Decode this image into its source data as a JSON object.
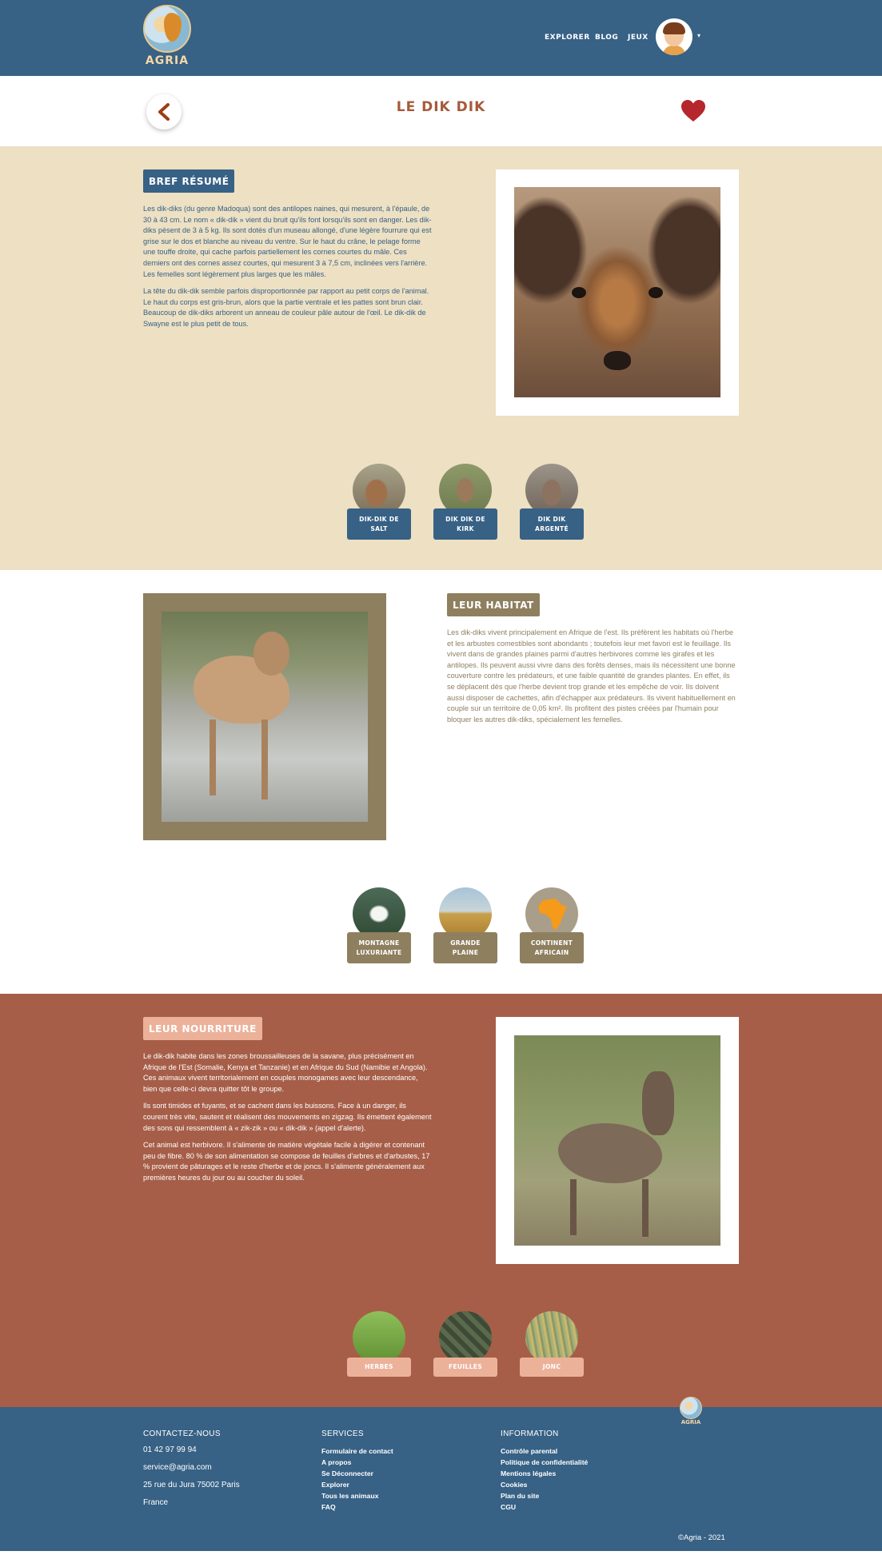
{
  "header": {
    "logo_text": "AGRIA",
    "nav": [
      "EXPLORER",
      "BLOG",
      "JEUX"
    ]
  },
  "title": "LE DIK DIK",
  "resume": {
    "tag": "BREF RÉSUMÉ",
    "paragraphs": [
      "Les dik-diks (du genre Madoqua) sont des antilopes naines, qui mesurent, à l'épaule, de 30 à 43 cm. Le nom « dik-dik » vient du bruit qu'ils font lorsqu'ils sont en danger. Les dik-diks pèsent de 3 à 5 kg. Ils sont dotés d'un museau allongé, d'une légère fourrure qui est grise sur le dos et blanche au niveau du ventre. Sur le haut du crâne, le pelage forme une touffe droite, qui cache parfois partiellement les cornes courtes du mâle. Ces derniers ont des cornes assez courtes, qui mesurent 3 à 7,5 cm, inclinées vers l'arrière. Les femelles sont légèrement plus larges que les mâles.",
      "La tête du dik-dik semble parfois disproportionnée par rapport au petit corps de l'animal. Le haut du corps est gris-brun, alors que la partie ventrale et les pattes sont brun clair. Beaucoup de dik-diks arborent un anneau de couleur pâle autour de l'œil. Le dik-dik de Swayne est le plus petit de tous."
    ],
    "thumbs": [
      "DIK-DIK DE SALT",
      "DIK DIK DE KIRK",
      "DIK DIK ARGENTÉ"
    ]
  },
  "habitat": {
    "tag": "LEUR HABITAT",
    "paragraphs": [
      "Les dik-diks vivent principalement en Afrique de l'est. Ils préfèrent les habitats où l'herbe et les arbustes comestibles sont abondants ; toutefois leur met favori est le feuillage. Ils vivent dans de grandes plaines parmi d'autres herbivores comme les girafes et les antilopes. Ils peuvent aussi vivre dans des forêts denses, mais ils nécessitent une bonne couverture contre les prédateurs, et une faible quantité de grandes plantes. En effet, ils se déplacent dès que l'herbe devient trop grande et les empêche de voir. Ils doivent aussi disposer de cachettes, afin d'échapper aux prédateurs. Ils vivent habituellement en couple sur un territoire de 0,05 km². Ils profitent des pistes créées par l'humain pour bloquer les autres dik-diks, spécialement les femelles."
    ],
    "thumbs": [
      "MONTAGNE LUXURIANTE",
      "GRANDE PLAINE",
      "CONTINENT AFRICAIN"
    ]
  },
  "food": {
    "tag": "LEUR NOURRITURE",
    "paragraphs": [
      "Le dik-dik habite dans les zones broussailleuses de la savane, plus précisément en Afrique de l'Est (Somalie, Kenya et Tanzanie) et en Afrique du Sud (Namibie et Angola). Ces animaux vivent territorialement en couples monogames avec leur descendance, bien que celle-ci devra quitter tôt le groupe.",
      "Ils sont timides et fuyants, et se cachent dans les buissons. Face à un danger, ils courent très vite, sautent et réalisent des mouvements en zigzag. Ils émettent également des sons qui ressemblent à « zik-zik » ou « dik-dik » (appel d'alerte).",
      "Cet animal est herbivore. Il s'alimente de matière végétale facile à digérer et contenant peu de fibre. 80 % de son alimentation se compose de feuilles d'arbres et d'arbustes, 17 % provient de pâturages et le reste d'herbe et de joncs. Il s'alimente généralement aux premières heures du jour ou au coucher du soleil."
    ],
    "thumbs": [
      "HERBES",
      "FEUILLES",
      "JONC"
    ]
  },
  "footer": {
    "contact": {
      "title": "CONTACTEZ-NOUS",
      "items": [
        "01 42 97 99 94",
        "service@agria.com",
        "25 rue du Jura 75002 Paris",
        "France"
      ]
    },
    "services": {
      "title": "SERVICES",
      "items": [
        "Formulaire de contact",
        "A propos",
        "Se Déconnecter",
        "Explorer",
        "Tous les animaux",
        "FAQ"
      ]
    },
    "information": {
      "title": "INFORMATION",
      "items": [
        "Contrôle parental",
        "Politique de confidentialité",
        "Mentions légales",
        "Cookies",
        "Plan du site",
        "CGU"
      ]
    },
    "logo_text": "AGRIA",
    "copyright": "©Agria - 2021"
  },
  "colors": {
    "header_blue": "#376185",
    "beige": "#ede0c3",
    "olive": "#8e7f5f",
    "terracotta": "#a65e48",
    "salmon": "#ecb199",
    "heart_red": "#b5262d",
    "title_brown": "#a65a3b"
  },
  "icons": {
    "back": "chevron-left-icon",
    "favorite": "heart-icon",
    "user_menu": "caret-down-icon"
  }
}
